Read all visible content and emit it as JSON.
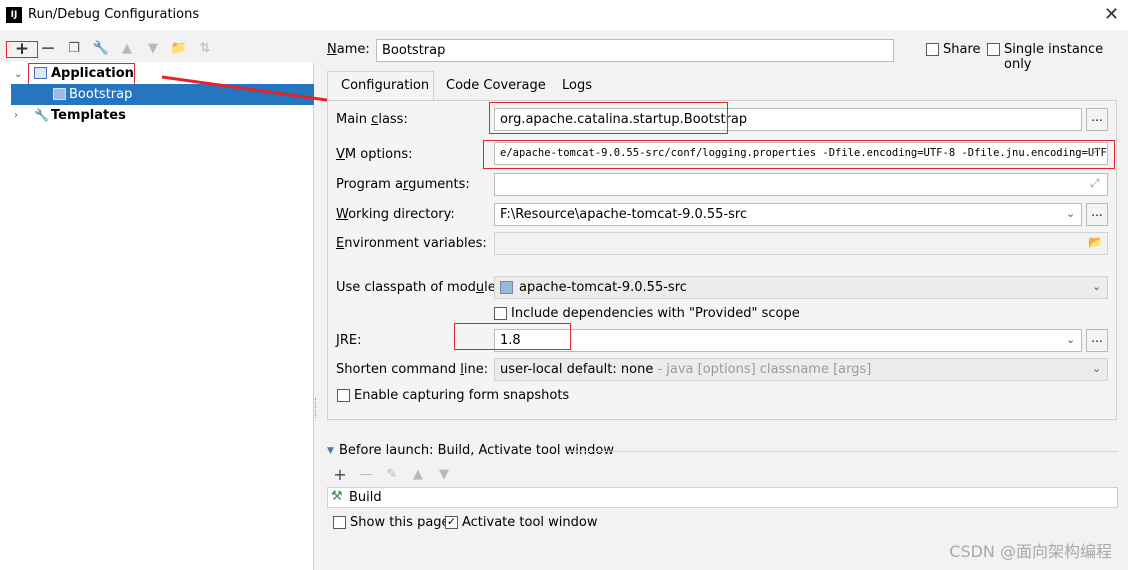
{
  "window": {
    "title": "Run/Debug Configurations",
    "logo": "IJ"
  },
  "tree": {
    "application": "Application",
    "bootstrap": "Bootstrap",
    "templates": "Templates"
  },
  "form": {
    "name_label": "Name:",
    "name_value": "Bootstrap",
    "share_label": "Share",
    "single_instance_label": "Single instance only",
    "tabs": [
      "Configuration",
      "Code Coverage",
      "Logs"
    ],
    "main_class_label": "Main class:",
    "main_class_value": "org.apache.catalina.startup.Bootstrap",
    "vm_options_label": "VM options:",
    "vm_options_value": "e/apache-tomcat-9.0.55-src/conf/logging.properties -Dfile.encoding=UTF-8 -Dfile.jnu.encoding=UTF-8",
    "program_args_label": "Program arguments:",
    "working_dir_label": "Working directory:",
    "working_dir_value": "F:\\Resource\\apache-tomcat-9.0.55-src",
    "env_vars_label": "Environment variables:",
    "classpath_label": "Use classpath of module:",
    "classpath_value": "apache-tomcat-9.0.55-src",
    "include_deps_label": "Include dependencies with \"Provided\" scope",
    "jre_label": "JRE:",
    "jre_value": "1.8",
    "shorten_label": "Shorten command line:",
    "shorten_value": "user-local default: none",
    "shorten_hint": " - java [options] classname [args]",
    "capture_label": "Enable capturing form snapshots",
    "dots": "..."
  },
  "before_launch": {
    "header": "Before launch: Build, Activate tool window",
    "build_item": "Build",
    "show_page_label": "Show this page",
    "activate_label": "Activate tool window"
  },
  "watermark": "CSDN @面向架构编程",
  "colors": {
    "selection": "#2675bf",
    "annotation_red": "#e0262a"
  }
}
